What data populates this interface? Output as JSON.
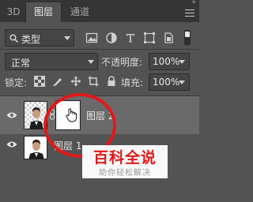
{
  "tabs": [
    {
      "label": "3D"
    },
    {
      "label": "图层"
    },
    {
      "label": "通道"
    }
  ],
  "filter": {
    "kind_label": "类型"
  },
  "blend": {
    "mode": "正常",
    "opacity_label": "不透明度:",
    "opacity_value": "100%"
  },
  "lock": {
    "label": "锁定:",
    "fill_label": "填充:",
    "fill_value": "100%"
  },
  "layers": [
    {
      "name": "图层 2",
      "selected": true
    },
    {
      "name": "图层 1",
      "selected": false
    }
  ],
  "watermark": {
    "title": "百科全说",
    "subtitle": "助你轻松解决"
  },
  "colors": {
    "accent_red": "#e11919",
    "panel_bg": "#535353",
    "selected_row": "#6a6a6a"
  }
}
